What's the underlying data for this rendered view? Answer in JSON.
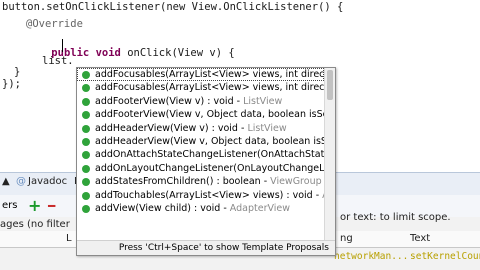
{
  "editor": {
    "line1": "button.setOnClickListener(new View.OnClickListener() {",
    "line2_annotation": "@Override",
    "line3_kw1": "public",
    "line3_kw2": "void",
    "line3_rest": "onClick(View v) {",
    "line4": "list.",
    "line5": "}",
    "line6": "});"
  },
  "bottom_panel": {
    "tab_console_label": "▲",
    "tab_javadoc_label": "Javadoc",
    "tab_declaration_label": "D",
    "left_label": "ers",
    "filter_label": "ages (no filter",
    "search_hint": "or text: to limit scope.",
    "col_log": "L",
    "col_tag": "ng",
    "col_text": "Text",
    "row_text1": "networkMan...",
    "row_text2": "setKernelCoun"
  },
  "autocomplete": {
    "items": [
      {
        "name": "addFocusables(ArrayList<View> views, int direction) : void",
        "type": ""
      },
      {
        "name": "addFocusables(ArrayList<View> views, int direction, int fo",
        "type": ""
      },
      {
        "name": "addFooterView(View v) : void - ",
        "type": "ListView"
      },
      {
        "name": "addFooterView(View v, Object data, boolean isSelectable)",
        "type": ""
      },
      {
        "name": "addHeaderView(View v) : void - ",
        "type": "ListView"
      },
      {
        "name": "addHeaderView(View v, Object data, boolean isSelectable",
        "type": ""
      },
      {
        "name": "addOnAttachStateChangeListener(OnAttachStateChange",
        "type": ""
      },
      {
        "name": "addOnLayoutChangeListener(OnLayoutChangeListener li",
        "type": ""
      },
      {
        "name": "addStatesFromChildren() : boolean - ",
        "type": "ViewGroup"
      },
      {
        "name": "addTouchables(ArrayList<View> views) : void - ",
        "type": "AbsListView"
      },
      {
        "name": "addView(View child) : void - ",
        "type": "AdapterView"
      }
    ],
    "status": "Press 'Ctrl+Space' to show Template Proposals"
  },
  "colors": {
    "keyword": "#7f0055",
    "method_icon": "#2fa33a",
    "popup_border": "#8a8a8a"
  }
}
